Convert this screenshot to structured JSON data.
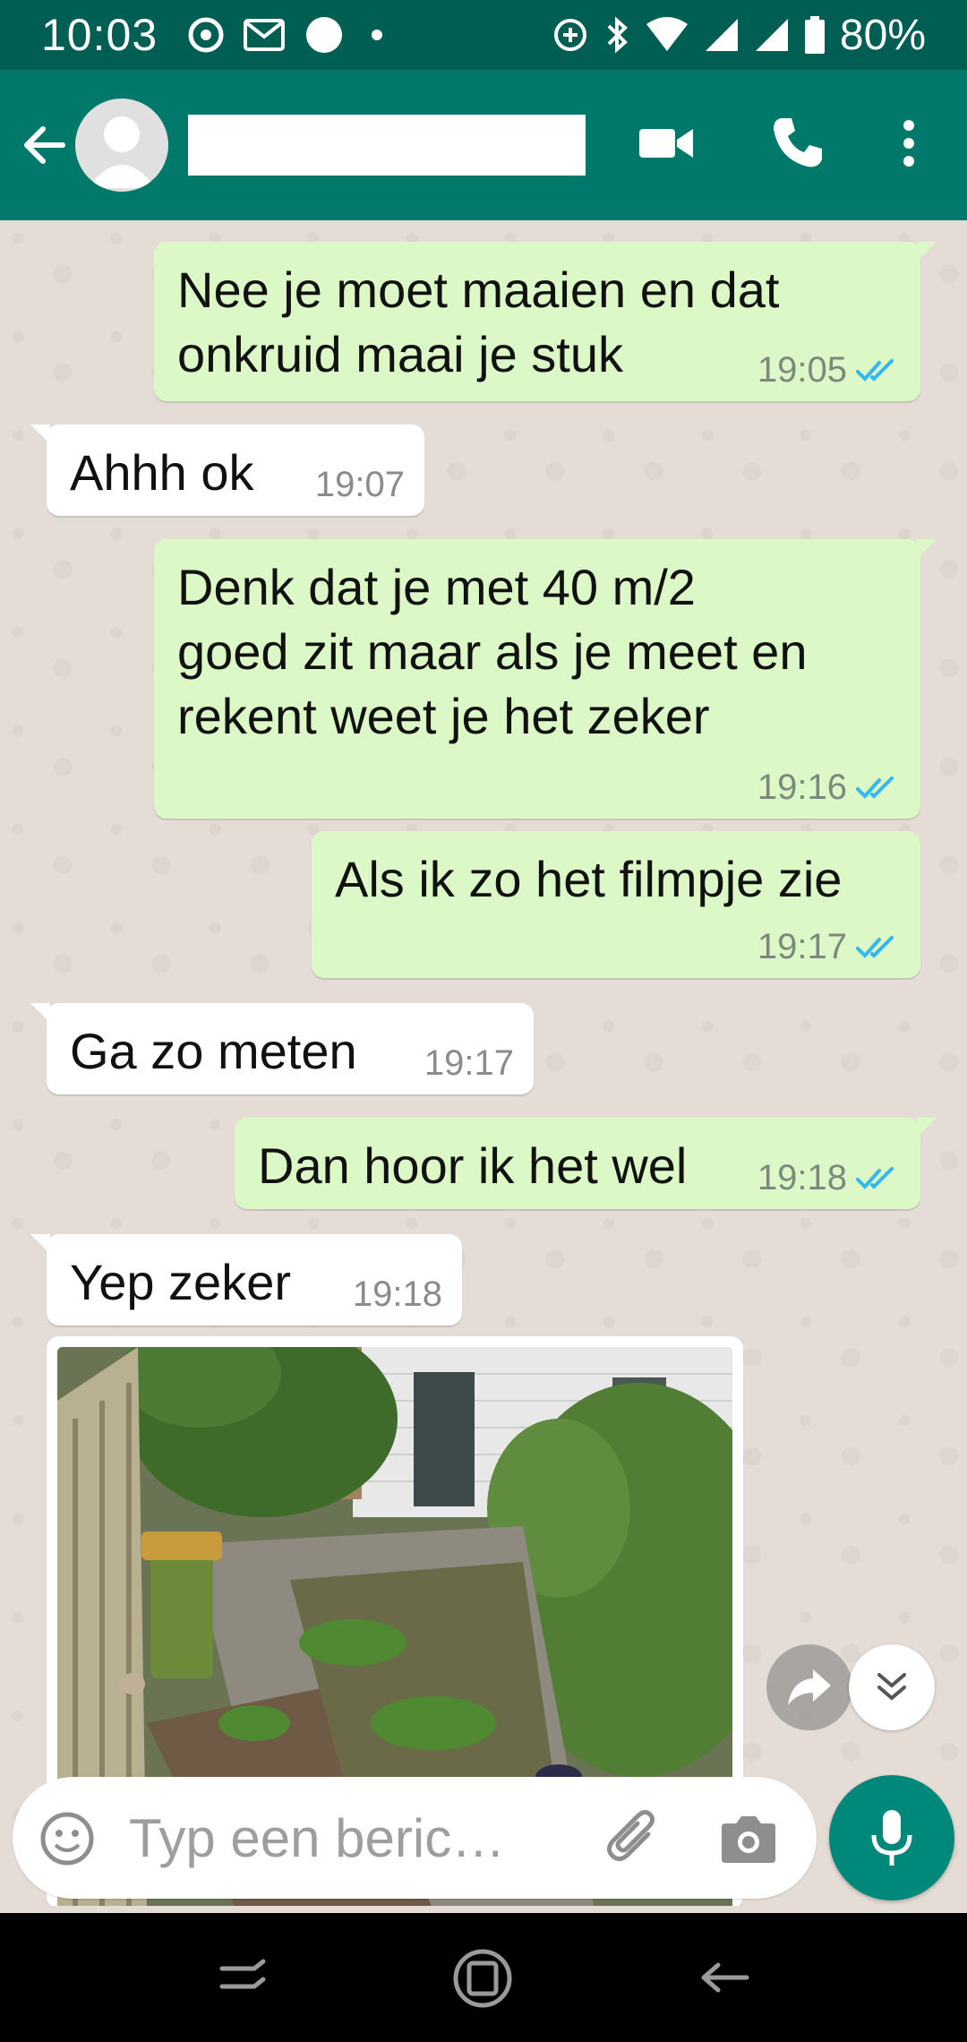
{
  "status_bar": {
    "time": "10:03",
    "battery": "80%"
  },
  "header": {
    "back_icon": "arrow-left-icon",
    "contact_name": "",
    "video_icon": "video-camera-icon",
    "call_icon": "phone-icon",
    "menu_icon": "more-vert-icon"
  },
  "messages": [
    {
      "dir": "out",
      "text": "Nee je moet maaien en dat\nonkruid maai je stuk",
      "time": "19:05",
      "read": true
    },
    {
      "dir": "in",
      "text": "Ahhh ok",
      "time": "19:07"
    },
    {
      "dir": "out",
      "text": "Denk dat je met 40 m/2\ngoed zit maar als je meet en\nrekent weet je het zeker",
      "time": "19:16",
      "read": true
    },
    {
      "dir": "out",
      "text": "Als ik zo het filmpje zie",
      "time": "19:17",
      "read": true
    },
    {
      "dir": "in",
      "text": "Ga zo meten",
      "time": "19:17"
    },
    {
      "dir": "out",
      "text": "Dan hoor ik het wel",
      "time": "19:18",
      "read": true
    },
    {
      "dir": "in",
      "text": "Yep zeker",
      "time": "19:18"
    },
    {
      "dir": "in",
      "type": "image",
      "image": "garden-photo"
    }
  ],
  "composer": {
    "placeholder": "Typ een beric…",
    "emoji_icon": "emoji-icon",
    "attach_icon": "paperclip-icon",
    "camera_icon": "camera-icon",
    "mic_icon": "microphone-icon"
  },
  "colors": {
    "status_bar": "#005e53",
    "app_bar": "#00796b",
    "outgoing_bubble": "#dcf8c6",
    "incoming_bubble": "#ffffff",
    "read_ticks": "#34b7f1",
    "mic_button": "#00897b"
  }
}
